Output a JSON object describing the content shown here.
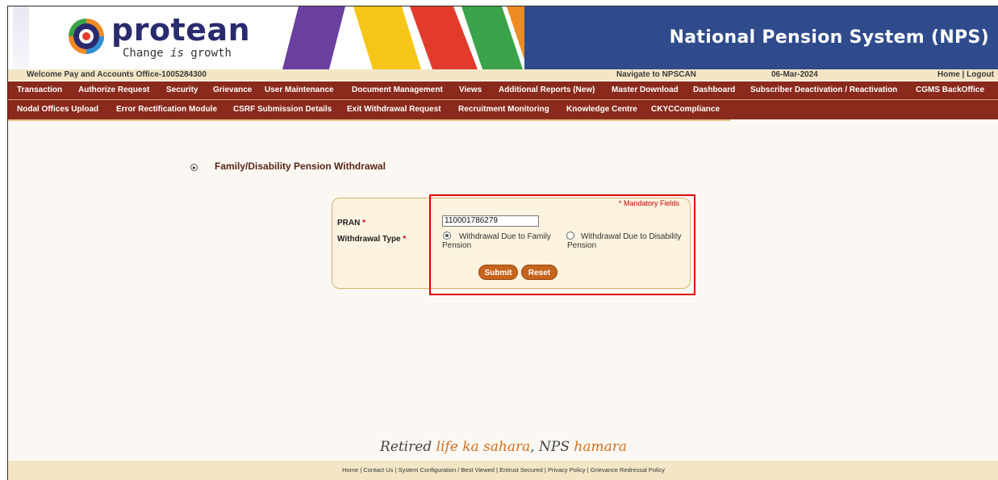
{
  "brand": {
    "name": "protean",
    "tagline_prefix": "Change ",
    "tagline_italic": "is",
    "tagline_suffix": " growth"
  },
  "site_title": "National Pension System (NPS)",
  "welcome": {
    "text": "Welcome Pay and Accounts Office-1005284300",
    "navigate": "Navigate to NPSCAN",
    "date": "06-Mar-2024",
    "home_logout": "Home | Logout"
  },
  "menu_row1": [
    "Transaction",
    "Authorize Request",
    "Security",
    "Grievance",
    "User Maintenance",
    "Document Management",
    "Views",
    "Additional Reports (New)",
    "Master Download",
    "Dashboard",
    "Subscriber Deactivation / Reactivation",
    "CGMS BackOffice"
  ],
  "menu_row2": [
    "Nodal Offices Upload",
    "Error Rectification Module",
    "CSRF Submission Details",
    "Exit Withdrawal Request",
    "Recruitment Monitoring",
    "Knowledge Centre",
    "CKYCCompliance"
  ],
  "page_heading": "Family/Disability Pension Withdrawal",
  "form": {
    "mandatory_note": "* Mandatory Fields",
    "pran_label": "PRAN",
    "pran_value": "110001786279",
    "withdrawal_type_label": "Withdrawal Type",
    "required_mark": "*",
    "option_family": "Withdrawal Due to Family Pension",
    "option_disability": "Withdrawal Due to Disability Pension",
    "selected_option": "family",
    "submit_label": "Submit",
    "reset_label": "Reset"
  },
  "footer": {
    "tagline_part1": "Retired ",
    "tagline_part2": "life ka sahara",
    "tagline_part3": ", NPS ",
    "tagline_part4": "hamara",
    "links": "Home | Contact Us | System Configuration / Best Viewed | Entrust Secured | Privacy Policy | Grievance Redressal Policy"
  },
  "colors": {
    "menu_bg": "#8a2a1c",
    "accent_orange": "#c5641c",
    "title_bar": "#2f4b8c",
    "highlight": "#e00000"
  }
}
